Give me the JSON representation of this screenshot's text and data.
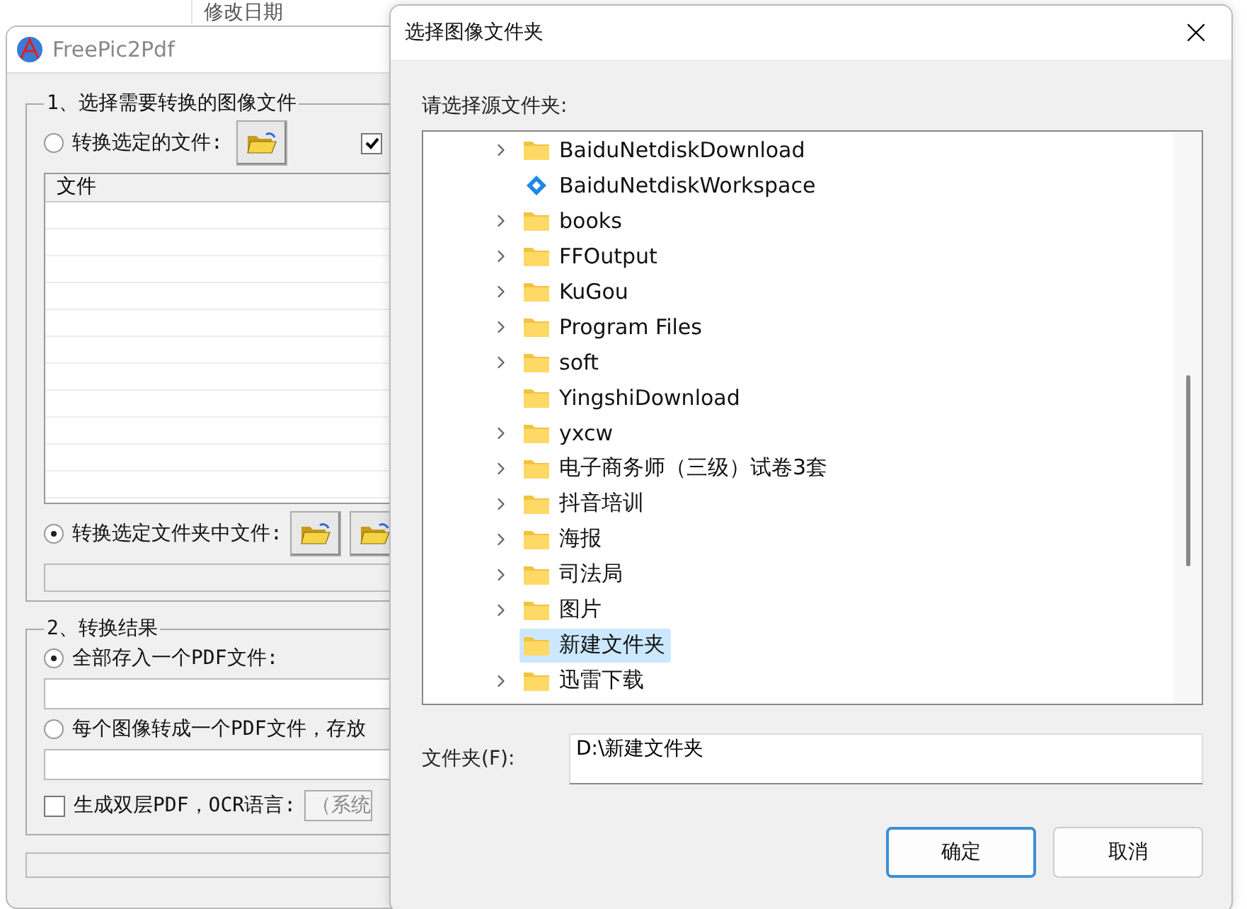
{
  "background_window": {
    "column_header": "修改日期"
  },
  "main_window": {
    "title": "FreePic2Pdf",
    "source_group": {
      "title": "1、选择需要转换的图像文件",
      "file_option": {
        "label": "转换选定的文件:",
        "selected": false
      },
      "side_checkbox": {
        "checked": true
      },
      "file_list": {
        "column": "文件"
      },
      "folder_option": {
        "label": "转换选定文件夹中文件:",
        "selected": true
      }
    },
    "result_group": {
      "title": "2、转换结果",
      "options": [
        {
          "label": "全部存入一个PDF文件:",
          "selected": true
        },
        {
          "label": "每个图像转成一个PDF文件，存放",
          "selected": false
        }
      ],
      "ocr": {
        "label": "生成双层PDF，OCR语言:",
        "checked": false,
        "language": "（系统"
      }
    }
  },
  "dialog": {
    "title": "选择图像文件夹",
    "prompt": "请选择源文件夹:",
    "tree": [
      {
        "label": "BaiduNetdiskDownload",
        "kind": "folder",
        "has_children": true,
        "selected": false
      },
      {
        "label": "BaiduNetdiskWorkspace",
        "kind": "workspace",
        "has_children": false,
        "selected": false
      },
      {
        "label": "books",
        "kind": "folder",
        "has_children": true,
        "selected": false
      },
      {
        "label": "FFOutput",
        "kind": "folder",
        "has_children": true,
        "selected": false
      },
      {
        "label": "KuGou",
        "kind": "folder",
        "has_children": true,
        "selected": false
      },
      {
        "label": "Program Files",
        "kind": "folder",
        "has_children": true,
        "selected": false
      },
      {
        "label": "soft",
        "kind": "folder",
        "has_children": true,
        "selected": false
      },
      {
        "label": "YingshiDownload",
        "kind": "folder",
        "has_children": false,
        "selected": false
      },
      {
        "label": "yxcw",
        "kind": "folder",
        "has_children": true,
        "selected": false
      },
      {
        "label": "电子商务师（三级）试卷3套",
        "kind": "folder",
        "has_children": true,
        "selected": false
      },
      {
        "label": "抖音培训",
        "kind": "folder",
        "has_children": true,
        "selected": false
      },
      {
        "label": "海报",
        "kind": "folder",
        "has_children": true,
        "selected": false
      },
      {
        "label": "司法局",
        "kind": "folder",
        "has_children": true,
        "selected": false
      },
      {
        "label": "图片",
        "kind": "folder",
        "has_children": true,
        "selected": false
      },
      {
        "label": "新建文件夹",
        "kind": "folder",
        "has_children": false,
        "selected": true
      },
      {
        "label": "迅雷下载",
        "kind": "folder",
        "has_children": true,
        "selected": false
      }
    ],
    "folder_label": "文件夹(F):",
    "folder_value": "D:\\新建文件夹",
    "buttons": [
      {
        "label": "确定",
        "default": true
      },
      {
        "label": "取消",
        "default": false
      }
    ]
  }
}
